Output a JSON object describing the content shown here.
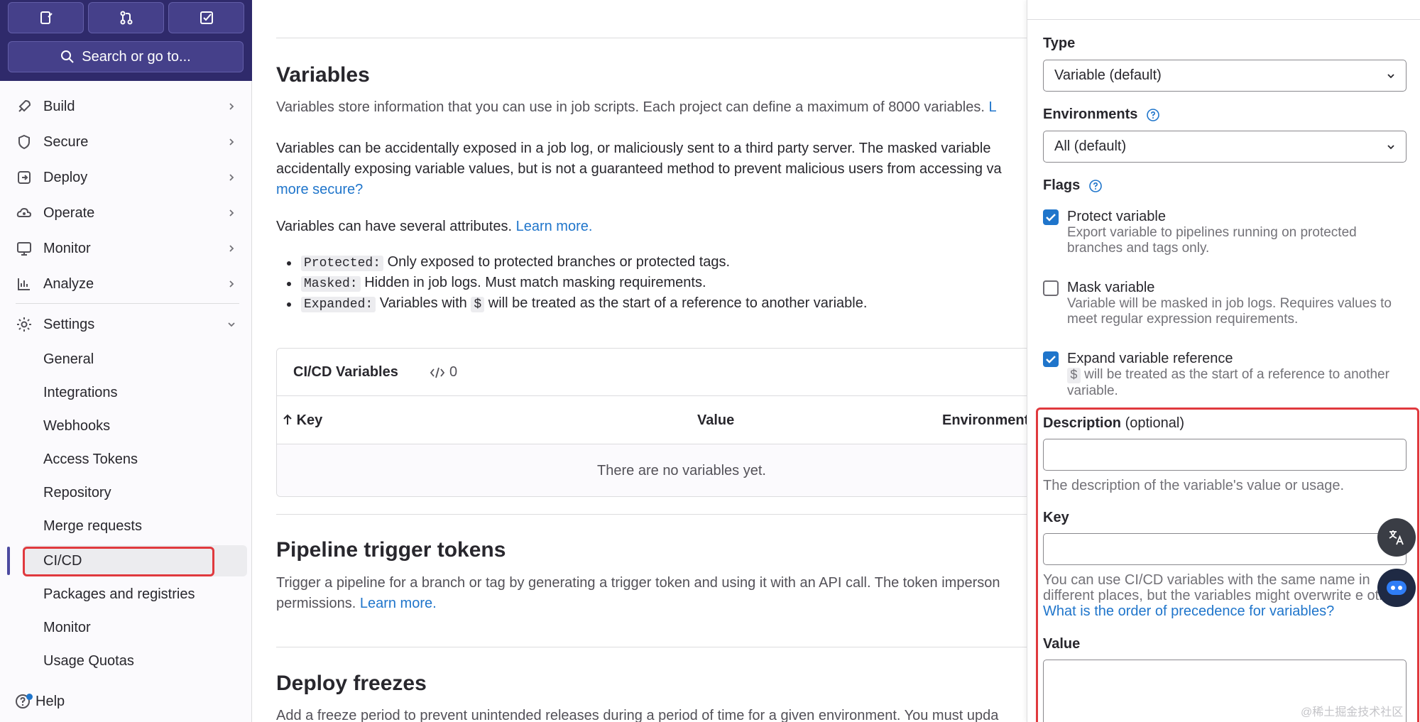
{
  "sidebar": {
    "search_label": "Search or go to...",
    "nav": [
      {
        "label": "Build",
        "icon": "rocket-icon"
      },
      {
        "label": "Secure",
        "icon": "shield-icon"
      },
      {
        "label": "Deploy",
        "icon": "deploy-icon"
      },
      {
        "label": "Operate",
        "icon": "cloud-gear-icon"
      },
      {
        "label": "Monitor",
        "icon": "monitor-icon"
      },
      {
        "label": "Analyze",
        "icon": "chart-icon"
      }
    ],
    "settings_label": "Settings",
    "settings_items": [
      "General",
      "Integrations",
      "Webhooks",
      "Access Tokens",
      "Repository",
      "Merge requests",
      "CI/CD",
      "Packages and registries",
      "Monitor",
      "Usage Quotas"
    ],
    "help_label": "Help"
  },
  "main": {
    "variables": {
      "title": "Variables",
      "intro": "Variables store information that you can use in job scripts. Each project can define a maximum of 8000 variables.",
      "intro_link": "L",
      "warning_line1": "Variables can be accidentally exposed in a job log, or maliciously sent to a third party server. The masked variable",
      "warning_line2": "accidentally exposing variable values, but is not a guaranteed method to prevent malicious users from accessing va",
      "warning_link": "more secure?",
      "attributes_text": "Variables can have several attributes.",
      "attributes_link": "Learn more.",
      "bullets": [
        {
          "code": "Protected:",
          "text": "Only exposed to protected branches or protected tags."
        },
        {
          "code": "Masked:",
          "text": "Hidden in job logs. Must match masking requirements."
        },
        {
          "code": "Expanded:",
          "text_before": "Variables with",
          "code2": "$",
          "text_after": "will be treated as the start of a reference to another variable."
        }
      ]
    },
    "ci_table": {
      "title": "CI/CD Variables",
      "count": "0",
      "columns": [
        "Key",
        "Value",
        "Environment"
      ],
      "empty": "There are no variables yet."
    },
    "pipeline": {
      "title": "Pipeline trigger tokens",
      "line1": "Trigger a pipeline for a branch or tag by generating a trigger token and using it with an API call. The token imperson",
      "line2": "permissions.",
      "link": "Learn more."
    },
    "deploy_freezes": {
      "title": "Deploy freezes",
      "line1": "Add a freeze period to prevent unintended releases during a period of time for a given environment. You must upda"
    }
  },
  "drawer": {
    "type_label": "Type",
    "type_value": "Variable (default)",
    "env_label": "Environments",
    "env_value": "All (default)",
    "flags_label": "Flags",
    "flags": [
      {
        "title": "Protect variable",
        "help": "Export variable to pipelines running on protected branches and tags only.",
        "checked": true
      },
      {
        "title": "Mask variable",
        "help": "Variable will be masked in job logs. Requires values to meet regular expression requirements.",
        "checked": false
      },
      {
        "title": "Expand variable reference",
        "help_code": "$",
        "help": "will be treated as the start of a reference to another variable.",
        "checked": true
      }
    ],
    "description_label": "Description",
    "description_optional": "(optional)",
    "description_value": "",
    "description_help": "The description of the variable's value or usage.",
    "key_label": "Key",
    "key_value": "",
    "key_help": "You can use CI/CD variables with the same name in different places, but the variables might overwrite e other.",
    "key_help_link": "What is the order of precedence for variables?",
    "value_label": "Value",
    "value_value": ""
  },
  "watermark": "@稀土掘金技术社区",
  "colors": {
    "accent": "#1f75cb",
    "highlight": "#e0393e",
    "sidebar_top": "#2f2a6b"
  }
}
